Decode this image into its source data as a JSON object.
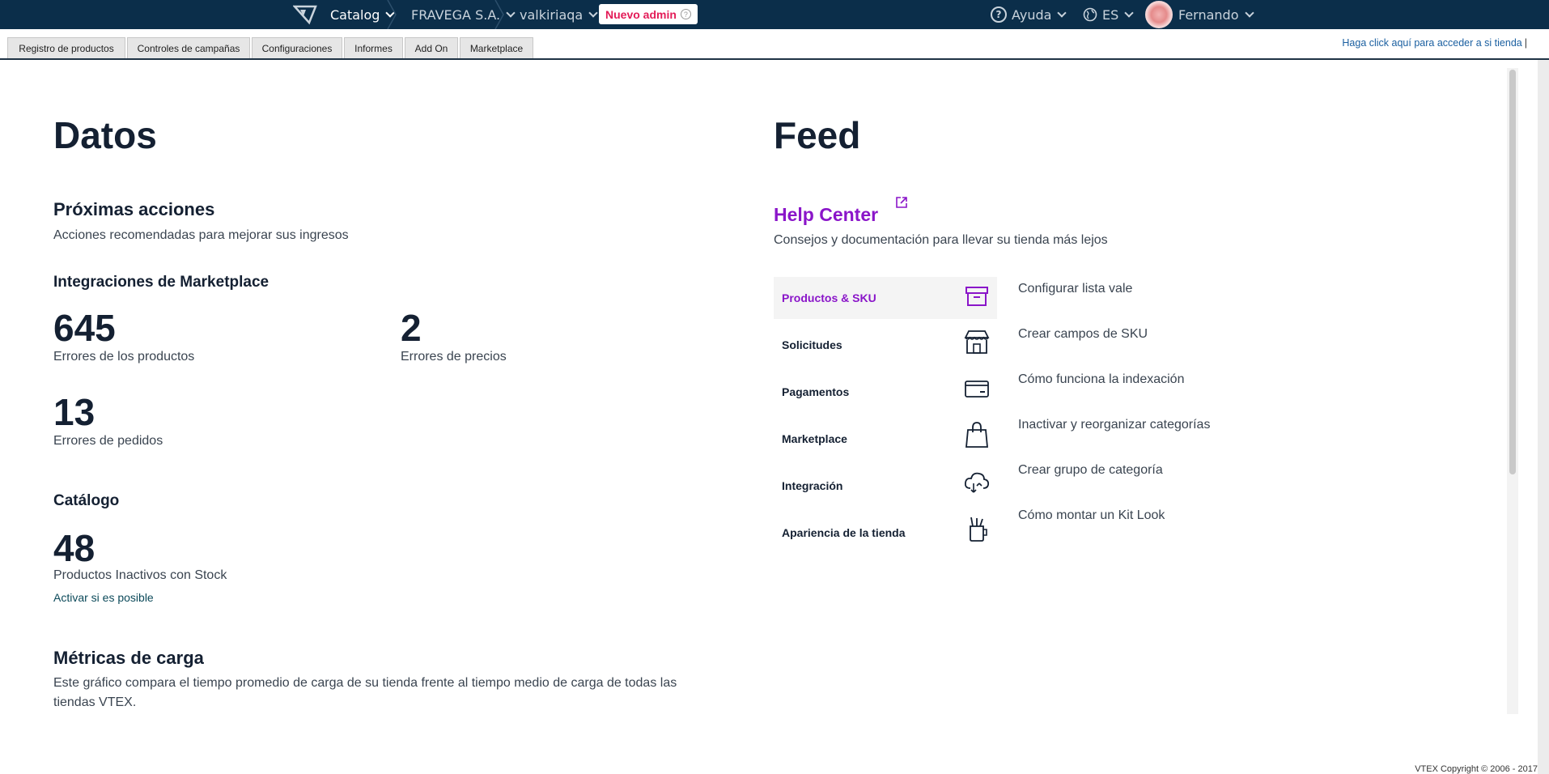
{
  "topbar": {
    "module": "Catalog",
    "account": "FRAVEGA S.A.",
    "workspace": "valkiriaqa",
    "new_admin": "Nuevo admin",
    "help": "Ayuda",
    "language": "ES",
    "user": "Fernando"
  },
  "tabs": [
    {
      "label": "Registro de productos"
    },
    {
      "label": "Controles de campañas"
    },
    {
      "label": "Configuraciones"
    },
    {
      "label": "Informes"
    },
    {
      "label": "Add On"
    },
    {
      "label": "Marketplace"
    }
  ],
  "store_link": "Haga click aquí para acceder a si tienda",
  "datos": {
    "title": "Datos",
    "next_actions": {
      "title": "Próximas acciones",
      "subtitle": "Acciones recomendadas para mejorar sus ingresos"
    },
    "marketplace": {
      "title": "Integraciones de Marketplace",
      "metrics": [
        {
          "value": "645",
          "label": "Errores de los productos"
        },
        {
          "value": "2",
          "label": "Errores de precios"
        },
        {
          "value": "13",
          "label": "Errores de pedidos"
        }
      ]
    },
    "catalog": {
      "title": "Catálogo",
      "value": "48",
      "label": "Productos Inactivos con Stock",
      "action": "Activar si es posible"
    },
    "load_metrics": {
      "title": "Métricas de carga",
      "description_line1": "Este gráfico compara el tiempo promedio de carga de su tienda frente al tiempo medio de carga de todas las",
      "description_line2": "tiendas VTEX."
    }
  },
  "feed": {
    "title": "Feed",
    "help_center": {
      "title": "Help Center",
      "subtitle": "Consejos y documentación para llevar su tienda más lejos"
    },
    "categories": [
      {
        "label": "Productos & SKU",
        "icon": "box-icon"
      },
      {
        "label": "Solicitudes",
        "icon": "store-icon"
      },
      {
        "label": "Pagamentos",
        "icon": "credit-card-icon"
      },
      {
        "label": "Marketplace",
        "icon": "shopping-bag-icon"
      },
      {
        "label": "Integración",
        "icon": "cloud-icon"
      },
      {
        "label": "Apariencia de la tienda",
        "icon": "brush-cup-icon"
      }
    ],
    "articles": [
      "Configurar lista vale",
      "Crear campos de SKU",
      "Cómo funciona la indexación",
      "Inactivar y reorganizar categorías",
      "Crear grupo de categoría",
      "Cómo montar un Kit Look"
    ]
  },
  "footer": "VTEX Copyright © 2006 - 2017",
  "colors": {
    "topbar": "#0b2e4a",
    "accent": "#8a15c9",
    "new_admin": "#e31c58",
    "text": "#142032"
  }
}
